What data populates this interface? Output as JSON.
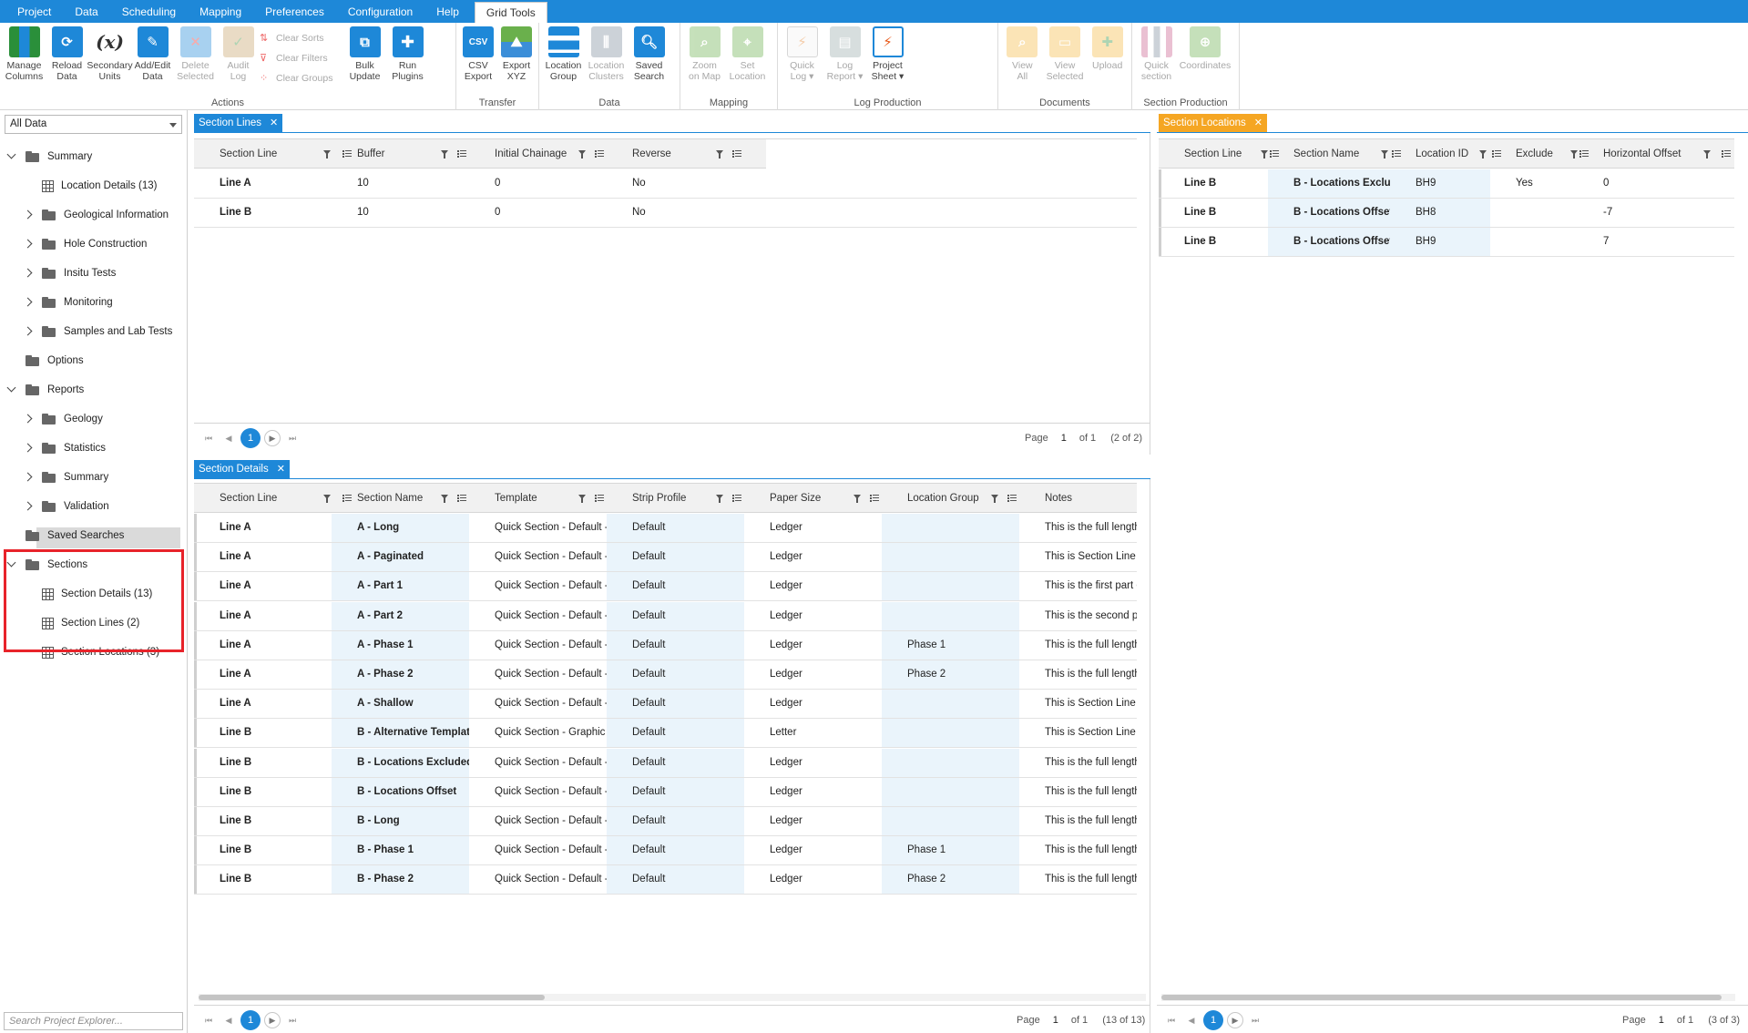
{
  "menu": {
    "tabs": [
      "Project",
      "Data",
      "Scheduling",
      "Mapping",
      "Preferences",
      "Configuration",
      "Help"
    ],
    "active_tab": "Grid Tools"
  },
  "ribbon": {
    "actions": {
      "group_label": "Actions",
      "manage_columns": "Manage\nColumns",
      "reload_data": "Reload\nData",
      "secondary_units": "Secondary\nUnits",
      "add_edit_data": "Add/Edit\nData",
      "delete_selected": "Delete\nSelected",
      "audit_log": "Audit\nLog",
      "clear_sorts": "Clear Sorts",
      "clear_filters": "Clear Filters",
      "clear_groups": "Clear Groups",
      "bulk_update": "Bulk\nUpdate",
      "run_plugins": "Run\nPlugins"
    },
    "transfer": {
      "group_label": "Transfer",
      "csv_export": "CSV\nExport",
      "export_xyz": "Export\nXYZ"
    },
    "data": {
      "group_label": "Data",
      "location_group": "Location\nGroup",
      "location_clusters": "Location\nClusters",
      "saved_search": "Saved\nSearch"
    },
    "mapping": {
      "group_label": "Mapping",
      "zoom_on_map": "Zoom\non Map",
      "set_location": "Set\nLocation"
    },
    "log_production": {
      "group_label": "Log Production",
      "quick_log": "Quick\nLog ▾",
      "log_report": "Log\nReport ▾",
      "project_sheet": "Project\nSheet ▾"
    },
    "documents": {
      "group_label": "Documents",
      "view_all": "View\nAll",
      "view_selected": "View\nSelected",
      "upload": "Upload"
    },
    "section_production": {
      "group_label": "Section Production",
      "quick_section": "Quick\nsection",
      "coordinates": "Coordinates"
    }
  },
  "explorer": {
    "scope": "All Data",
    "search_placeholder": "Search Project Explorer...",
    "items": [
      "Summary",
      "Location Details (13)",
      "Geological Information",
      "Hole Construction",
      "Insitu Tests",
      "Monitoring",
      "Samples and Lab Tests",
      "Options",
      "Reports",
      "Geology",
      "Statistics",
      "Summary",
      "Validation",
      "Saved Searches",
      "Sections",
      "Section Details (13)",
      "Section Lines (2)",
      "Section Locations (3)"
    ]
  },
  "section_lines": {
    "tab": "Section Lines",
    "columns": [
      "Section Line",
      "Buffer",
      "Initial Chainage",
      "Reverse"
    ],
    "rows": [
      [
        "Line A",
        "10",
        "0",
        "No"
      ],
      [
        "Line B",
        "10",
        "0",
        "No"
      ]
    ],
    "pager": {
      "page_label": "Page",
      "page": "1",
      "of": "of 1",
      "count": "(2 of 2)",
      "current": "1"
    }
  },
  "section_details": {
    "tab": "Section Details",
    "columns": [
      "Section Line",
      "Section Name",
      "Template",
      "Strip Profile",
      "Paper Size",
      "Location Group",
      "Notes"
    ],
    "rows": [
      [
        "Line A",
        "A - Long",
        "Quick Section - Default -...",
        "Default",
        "Ledger",
        "",
        "This is the full length"
      ],
      [
        "Line A",
        "A - Paginated",
        "Quick Section - Default -...",
        "Default",
        "Ledger",
        "",
        "This is Section Line A"
      ],
      [
        "Line A",
        "A - Part 1",
        "Quick Section - Default -...",
        "Default",
        "Ledger",
        "",
        "This is the first part o"
      ],
      [
        "Line A",
        "A - Part 2",
        "Quick Section - Default -...",
        "Default",
        "Ledger",
        "",
        "This is the second pa"
      ],
      [
        "Line A",
        "A - Phase 1",
        "Quick Section - Default -...",
        "Default",
        "Ledger",
        "Phase 1",
        "This is the full length"
      ],
      [
        "Line A",
        "A - Phase 2",
        "Quick Section - Default -...",
        "Default",
        "Ledger",
        "Phase 2",
        "This is the full length"
      ],
      [
        "Line A",
        "A - Shallow",
        "Quick Section - Default -...",
        "Default",
        "Ledger",
        "",
        "This is Section Line A"
      ],
      [
        "Line B",
        "B - Alternative Template",
        "Quick Section - Graphic L...",
        "Default",
        "Letter",
        "",
        "This is Section Line B"
      ],
      [
        "Line B",
        "B - Locations Excluded",
        "Quick Section - Default -...",
        "Default",
        "Ledger",
        "",
        "This is the full length"
      ],
      [
        "Line B",
        "B - Locations Offset",
        "Quick Section - Default -...",
        "Default",
        "Ledger",
        "",
        "This is the full length"
      ],
      [
        "Line B",
        "B - Long",
        "Quick Section - Default -...",
        "Default",
        "Ledger",
        "",
        "This is the full length"
      ],
      [
        "Line B",
        "B - Phase 1",
        "Quick Section - Default -...",
        "Default",
        "Ledger",
        "Phase 1",
        "This is the full length"
      ],
      [
        "Line B",
        "B - Phase 2",
        "Quick Section - Default -...",
        "Default",
        "Ledger",
        "Phase 2",
        "This is the full length"
      ]
    ],
    "pager": {
      "page_label": "Page",
      "page": "1",
      "of": "of 1",
      "count": "(13 of 13)",
      "current": "1"
    }
  },
  "section_locations": {
    "tab": "Section Locations",
    "columns": [
      "Section Line",
      "Section Name",
      "Location ID",
      "Exclude",
      "Horizontal Offset"
    ],
    "rows": [
      [
        "Line B",
        "B - Locations Excluded",
        "BH9",
        "Yes",
        "0"
      ],
      [
        "Line B",
        "B - Locations Offset",
        "BH8",
        "",
        "-7"
      ],
      [
        "Line B",
        "B - Locations Offset",
        "BH9",
        "",
        "7"
      ]
    ],
    "pager": {
      "page_label": "Page",
      "page": "1",
      "of": "of 1",
      "count": "(3 of 3)",
      "current": "1"
    }
  },
  "colors": {
    "accent": "#1e88d8",
    "highlight_tab": "#f5a623",
    "annotation_box": "#e8232a"
  }
}
